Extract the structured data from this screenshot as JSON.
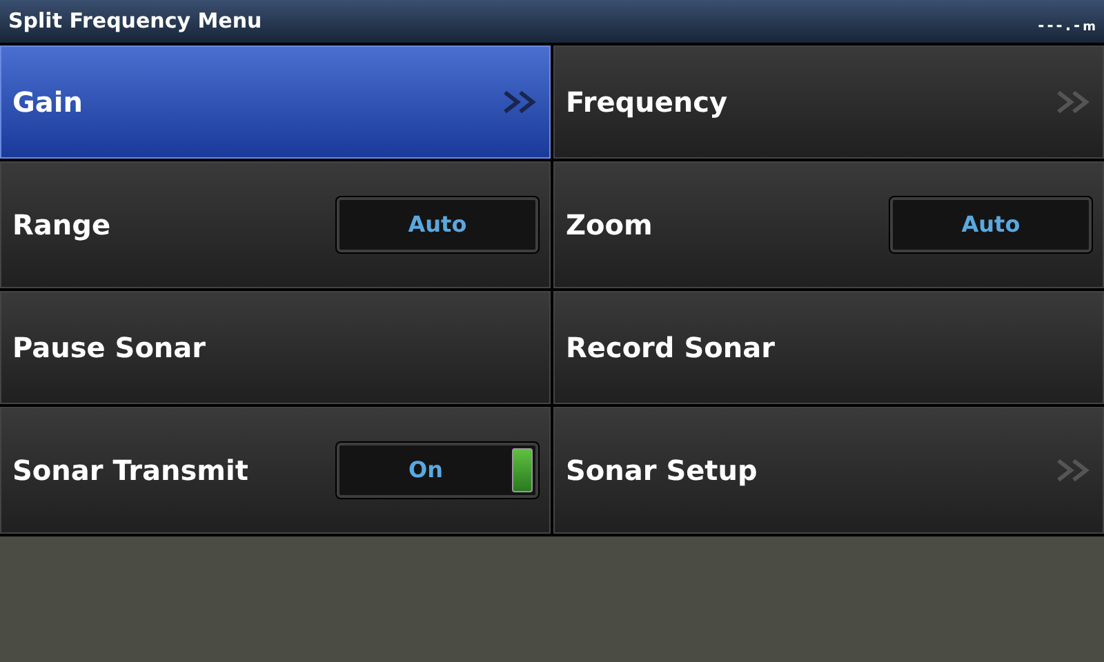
{
  "window": {
    "title": "Split Frequency Menu",
    "depth_reading": "---.-",
    "depth_unit": "m"
  },
  "menu_items": [
    {
      "label": "Gain",
      "kind": "submenu",
      "selected": true
    },
    {
      "label": "Frequency",
      "kind": "submenu",
      "selected": false
    },
    {
      "label": "Range",
      "kind": "value",
      "value": "Auto",
      "selected": false
    },
    {
      "label": "Zoom",
      "kind": "value",
      "value": "Auto",
      "selected": false
    },
    {
      "label": "Pause Sonar",
      "kind": "action",
      "selected": false
    },
    {
      "label": "Record Sonar",
      "kind": "action",
      "selected": false
    },
    {
      "label": "Sonar Transmit",
      "kind": "toggle",
      "value": "On",
      "on": true,
      "selected": false
    },
    {
      "label": "Sonar Setup",
      "kind": "submenu",
      "selected": false
    }
  ]
}
